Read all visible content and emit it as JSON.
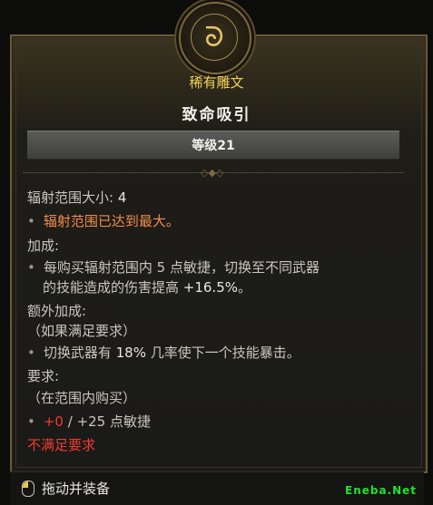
{
  "header": {
    "emblem_glyph": "ᘐ",
    "rarity": "稀有雕文",
    "name": "致命吸引",
    "level": "等级21"
  },
  "stats": {
    "radius_label": "辐射范围大小:",
    "radius_value": "4",
    "radius_note": "辐射范围已达到最大。"
  },
  "bonus": {
    "heading": "加成:",
    "line1": "每购买辐射范围内 5 点敏捷，切换至不同武器",
    "line2_prefix": "的技能造成的伤害提高 ",
    "line2_value": "+16.5%",
    "line2_suffix": "。"
  },
  "additional": {
    "heading": "额外加成:",
    "condition": "（如果满足要求）",
    "text_prefix": "切换武器有 ",
    "text_value": "18%",
    "text_suffix": " 几率使下一个技能暴击。"
  },
  "requirements": {
    "heading": "要求:",
    "condition": "（在范围内购买）",
    "current": "+0",
    "needed": " / +25 点敏捷",
    "status": "不满足要求"
  },
  "footer": {
    "action": "拖动并装备",
    "watermark": "Eneba.Net"
  }
}
